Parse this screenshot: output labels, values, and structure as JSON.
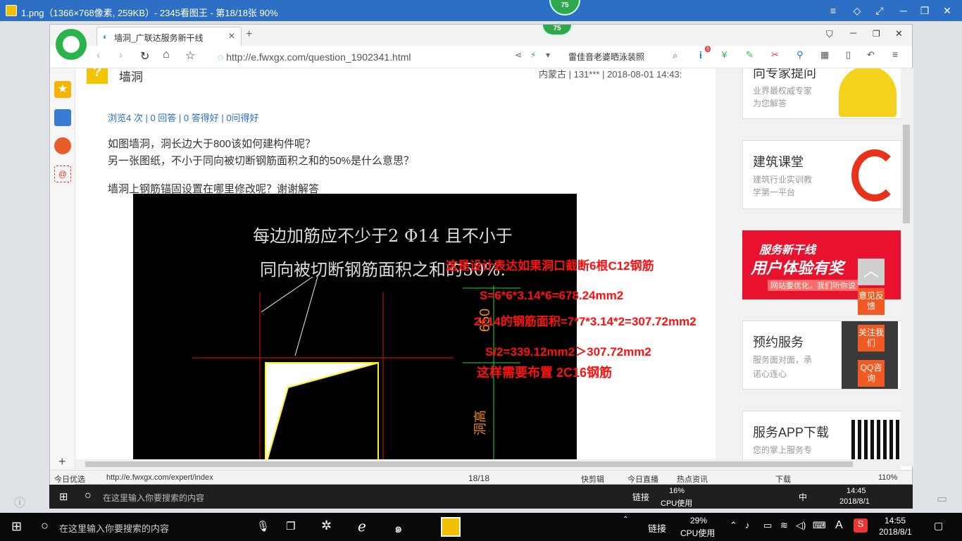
{
  "viewer": {
    "title": "1.png（1366×768像素, 259KB）- 2345看图王 - 第18/18张 90%",
    "badge": "75",
    "page_counter": "18/18"
  },
  "browser": {
    "badge": "75",
    "tab_title": "墙洞_广联达服务新干线",
    "url": "http://e.fwxgx.com/question_1902341.html",
    "search_text": "雷佳音老婆晒泳装照",
    "plugin_badge": "6"
  },
  "question": {
    "title": "墙洞",
    "meta": "内蒙古 | 131*** | 2018-08-01 14:43:",
    "stats": "浏览4 次 | 0 回答 | 0 答得好 | 0问得好",
    "line1": "如图墙洞，洞长边大于800该如何建构件呢？",
    "line2": "另一张图纸，不小于同向被切断钢筋面积之和的50%是什么意思？",
    "line3": "墙洞上钢筋锚固设置在哪里修改呢？谢谢解答"
  },
  "drawing": {
    "note_line1": "每边加筋应不少于2 Φ14 且不小于",
    "note_line2": "同向被切断钢筋面积之和的50%.",
    "dim_650": "650",
    "dim_label": "洞高",
    "annot1": "这是设计表达如果洞口截断6根C12钢筋",
    "annot2": "S=6*6*3.14*6=678.24mm2",
    "annot3": "2c14的钢筋面积=7*7*3.14*2=307.72mm2",
    "annot4": "S/2=339.12mm2＞307.72mm2",
    "annot5": "这样需要布置 2C16钢筋"
  },
  "sidebar": {
    "card1": {
      "title": "向专家提问",
      "sub1": "业界最权威专家",
      "sub2": "为您解答"
    },
    "card2": {
      "title": "建筑课堂",
      "sub1": "建筑行业实训教",
      "sub2": "学第一平台"
    },
    "banner": {
      "line1": "服务新干线",
      "line2": "用户体验有奖",
      "line3": "网站要优化，我们听你说"
    },
    "card3": {
      "title": "预约服务",
      "sub1": "服务面对面，承",
      "sub2": "诺心连心"
    },
    "card4": {
      "title": "服务APP下载",
      "sub1": "您的掌上服务专"
    },
    "float1": "意见反馈",
    "float2": "关注我们",
    "float3": "QQ咨询"
  },
  "statusbar": {
    "left": "今日优选",
    "url": "http://e.fwxgx.com/expert/index",
    "items": [
      "快剪辑",
      "今日直播",
      "热点资讯",
      "下载"
    ],
    "zoom": "110%"
  },
  "inner_taskbar": {
    "search_placeholder": "在这里输入你要搜索的内容",
    "link": "链接",
    "cpu_percent": "16%",
    "cpu_label": "CPU使用",
    "ime": "中",
    "time": "14:45",
    "date": "2018/8/1"
  },
  "taskbar": {
    "search_placeholder": "在这里输入你要搜索的内容",
    "link": "链接",
    "cpu_percent": "29%",
    "cpu_label": "CPU使用",
    "ime": "A",
    "time": "14:55",
    "date": "2018/8/1"
  }
}
